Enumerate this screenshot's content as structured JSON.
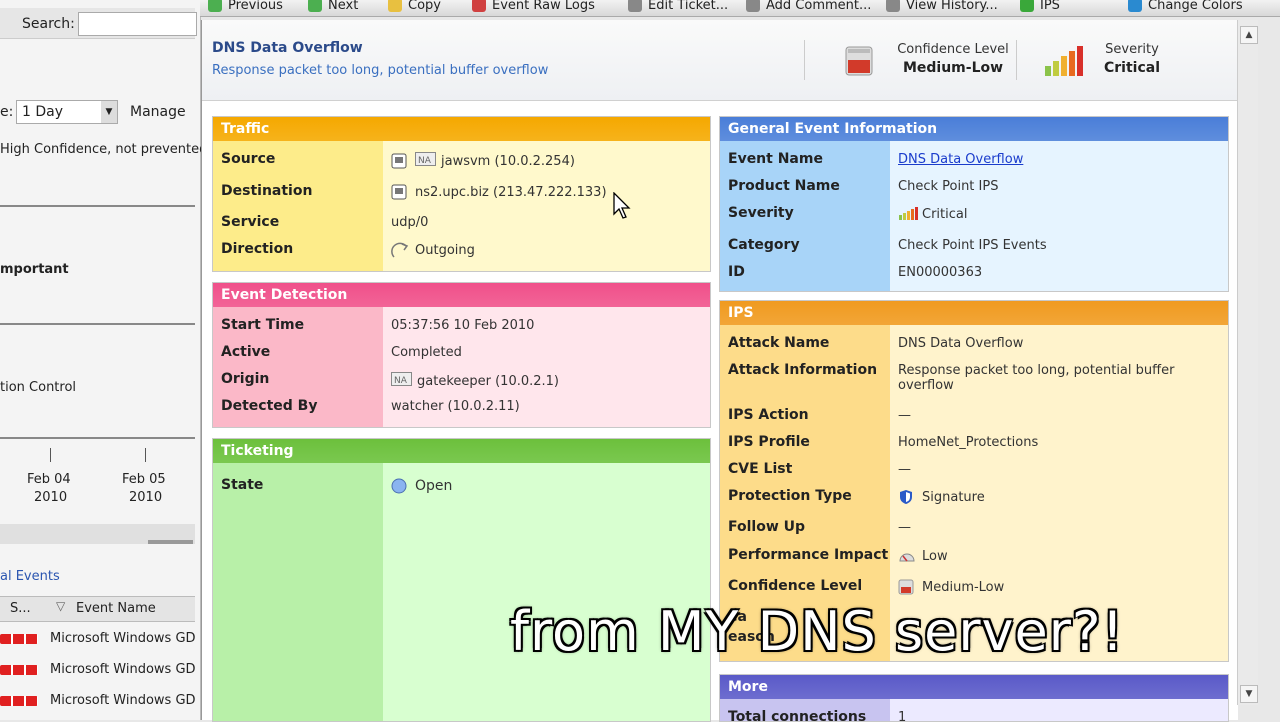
{
  "toolbar": {
    "items": [
      "Previous",
      "Next",
      "Copy",
      "Event Raw Logs",
      "Edit Ticket...",
      "Add Comment...",
      "View History...",
      "IPS",
      "Change Colors"
    ]
  },
  "left": {
    "search_label": "Search:",
    "period_prefix": "e:",
    "period_value": "1 Day",
    "manage": "Manage",
    "confidence_text": "High Confidence, not prevented",
    "important": "mportant",
    "control": "tion Control",
    "date1": "Feb 04",
    "date1_year": "2010",
    "date2": "Feb 05",
    "date2_year": "2010",
    "events_title": "al Events",
    "col_s": "S...",
    "col_event": "Event Name",
    "rows": [
      "Microsoft Windows GD",
      "Microsoft Windows GD",
      "Microsoft Windows GD"
    ]
  },
  "header": {
    "title": "DNS Data Overflow",
    "subtitle": "Response packet too long, potential buffer overflow",
    "confidence_label": "Confidence Level",
    "confidence_value": "Medium-Low",
    "severity_label": "Severity",
    "severity_value": "Critical"
  },
  "traffic": {
    "title": "Traffic",
    "rows": [
      {
        "label": "Source",
        "prefix": "NA",
        "value": "jawsvm (10.0.2.254)"
      },
      {
        "label": "Destination",
        "prefix": "",
        "value": "ns2.upc.biz (213.47.222.133)"
      },
      {
        "label": "Service",
        "prefix": "",
        "value": "udp/0"
      },
      {
        "label": "Direction",
        "prefix": "",
        "value": "Outgoing"
      }
    ]
  },
  "detection": {
    "title": "Event Detection",
    "rows": [
      {
        "label": "Start Time",
        "prefix": "",
        "value": "05:37:56 10 Feb 2010"
      },
      {
        "label": "Active",
        "prefix": "",
        "value": "Completed"
      },
      {
        "label": "Origin",
        "prefix": "NA",
        "value": "gatekeeper (10.0.2.1)"
      },
      {
        "label": "Detected By",
        "prefix": "",
        "value": "watcher (10.0.2.11)"
      }
    ]
  },
  "ticketing": {
    "title": "Ticketing",
    "state_label": "State",
    "state_value": "Open"
  },
  "general": {
    "title": "General Event Information",
    "rows": [
      {
        "label": "Event Name",
        "value": "DNS Data Overflow"
      },
      {
        "label": "Product Name",
        "value": "Check Point IPS"
      },
      {
        "label": "Severity",
        "value": "Critical"
      },
      {
        "label": "Category",
        "value": "Check Point IPS Events"
      },
      {
        "label": "ID",
        "value": "EN00000363"
      }
    ]
  },
  "ips": {
    "title": "IPS",
    "rows": [
      {
        "label": "Attack Name",
        "value": "DNS Data Overflow"
      },
      {
        "label": "Attack Information",
        "value": "Response packet too long, potential buffer",
        "value2": "overflow"
      },
      {
        "label": "IPS Action",
        "value": "—"
      },
      {
        "label": "IPS Profile",
        "value": "HomeNet_Protections"
      },
      {
        "label": "CVE List",
        "value": "—"
      },
      {
        "label": "Protection Type",
        "value": "Signature"
      },
      {
        "label": "Follow Up",
        "value": "—"
      },
      {
        "label": "Performance Impact",
        "value": "Low"
      },
      {
        "label": "Confidence Level",
        "value": "Medium-Low"
      },
      {
        "label": "ea",
        "value": ""
      },
      {
        "label": "eason",
        "value": ""
      }
    ]
  },
  "more": {
    "title": "More",
    "row_label": "Total connections",
    "row_value": "1"
  },
  "caption": "from MY DNS server?!",
  "colors": {
    "traffic_head": "#f5a800",
    "detection_head": "#f0508a",
    "ticketing_head": "#6cc03c",
    "general_head": "#4a7ed8",
    "ips_head": "#f09a20",
    "more_head": "#5a5ac8"
  }
}
